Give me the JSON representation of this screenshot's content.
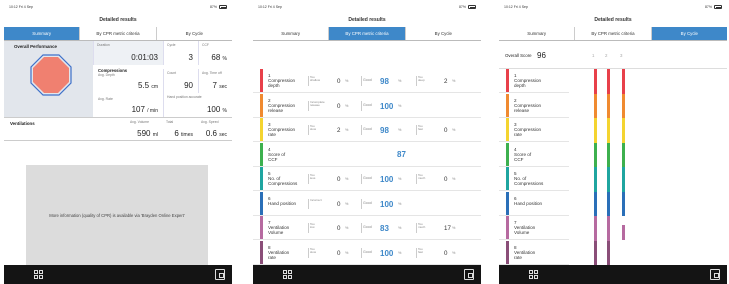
{
  "status": {
    "time": "10:12 Fri 4 Sep",
    "battery": "87%"
  },
  "title": "Detailed results",
  "tabs": [
    "Summary",
    "By CPR metric criteria",
    "By Cycle"
  ],
  "summary": {
    "overall_performance": "Overall Performance",
    "duration": {
      "label": "Duration",
      "value": "0:01:03"
    },
    "cycle": {
      "label": "Cycle",
      "value": "3"
    },
    "ccf": {
      "label": "CCF",
      "value": "68",
      "unit": "%"
    },
    "compressions_title": "Compressions",
    "avg_depth": {
      "label": "Avg. Depth",
      "value": "5.5",
      "unit": "cm"
    },
    "count": {
      "label": "Count",
      "value": "90"
    },
    "avg_time_off": {
      "label": "Avg. Time off",
      "value": "7",
      "unit": "sec"
    },
    "avg_rate": {
      "label": "Avg. Rate",
      "value": "107",
      "unit": "/ min"
    },
    "hand_position": {
      "label": "Hand position  accurate",
      "value": "100",
      "unit": "%"
    },
    "ventilations_title": "Ventilations",
    "avg_volume": {
      "label": "Avg. Volume",
      "value": "590",
      "unit": "ml"
    },
    "total": {
      "label": "Total",
      "value": "6",
      "unit": "times"
    },
    "avg_speed": {
      "label": "Avg. Speed",
      "value": "0.6",
      "unit": "sec"
    },
    "info_text": "More information (quality of CPR) is available via 'Brayden Online Expert'",
    "octagon_fill": "#f08070",
    "octagon_outline": "#3e70c9"
  },
  "metrics": [
    {
      "name": "1\nCompression\ndepth",
      "color": "#e8404a",
      "left_label": "Too\nshallow",
      "left_value": "0",
      "good": "98",
      "right_label": "Too\ndeep",
      "right_value": "2"
    },
    {
      "name": "2\nCompression\nrelease",
      "color": "#f08a30",
      "left_label": "Incomplete\nrelease",
      "left_value": "0",
      "good": "100",
      "right_label": "",
      "right_value": ""
    },
    {
      "name": "3\nCompression\nrate",
      "color": "#f4d430",
      "left_label": "Too\nslow",
      "left_value": "2",
      "good": "98",
      "right_label": "Too\nfast",
      "right_value": "0"
    },
    {
      "name": "4\nScore of\nCCF",
      "color": "#3db04e",
      "ccf": "87"
    },
    {
      "name": "5\nNo. of\nCompressions",
      "color": "#1fa5a0",
      "left_label": "Too\nless",
      "left_value": "0",
      "good": "100",
      "right_label": "Too\nmuch",
      "right_value": "0"
    },
    {
      "name": "6\nHand position",
      "color": "#2a6fb8",
      "left_label": "Incorrect",
      "left_value": "0",
      "good": "100",
      "right_label": "",
      "right_value": ""
    },
    {
      "name": "7\nVentilation\nVolume",
      "color": "#b66aa0",
      "left_label": "Too\nlow",
      "left_value": "0",
      "good": "83",
      "right_label": "Too\nmuch",
      "right_value": "17"
    },
    {
      "name": "8\nVentilation\nrate",
      "color": "#8a4e78",
      "left_label": "Too\nslow",
      "left_value": "0",
      "good": "100",
      "right_label": "Too\nfast",
      "right_value": "0"
    }
  ],
  "good_label": "Good",
  "percent": "%",
  "by_cycle": {
    "overall_label": "Overall Score",
    "overall_value": "96",
    "cycles": [
      "1",
      "2",
      "3"
    ]
  }
}
